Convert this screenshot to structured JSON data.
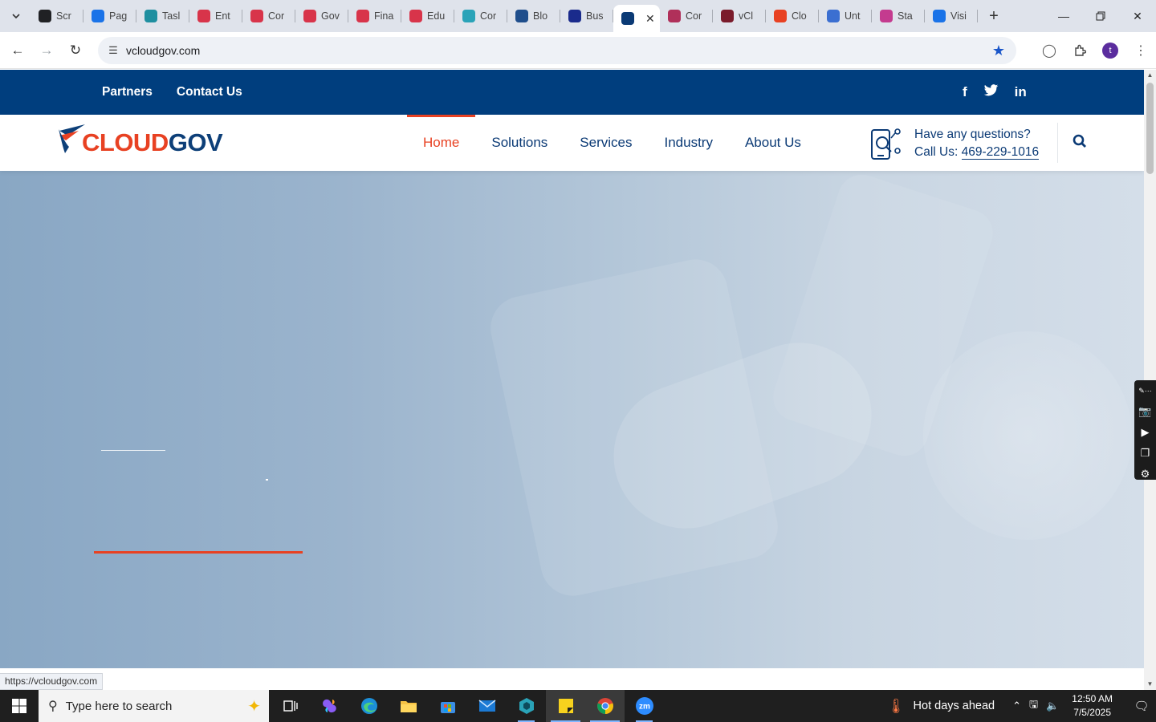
{
  "browser": {
    "tabs": [
      {
        "label": "Scr",
        "icon": "settings-gear-icon",
        "color": "#202124"
      },
      {
        "label": "Pag",
        "icon": "pagespeed-icon",
        "color": "#1a73e8"
      },
      {
        "label": "Tasl",
        "icon": "task-icon",
        "color": "#1e8fa0"
      },
      {
        "label": "Ent",
        "icon": "gov-diamond-icon",
        "color": "#d8344a"
      },
      {
        "label": "Cor",
        "icon": "gov-diamond-icon",
        "color": "#d8344a"
      },
      {
        "label": "Gov",
        "icon": "gov-diamond-icon",
        "color": "#d8344a"
      },
      {
        "label": "Fina",
        "icon": "gov-diamond-icon",
        "color": "#d8344a"
      },
      {
        "label": "Edu",
        "icon": "gov-diamond-icon",
        "color": "#d8344a"
      },
      {
        "label": "Cor",
        "icon": "hex-icon",
        "color": "#2aa3b8"
      },
      {
        "label": "Blo",
        "icon": "scale-icon",
        "color": "#1f4e8c"
      },
      {
        "label": "Bus",
        "icon": "x-logo-icon",
        "color": "#1a2b8c"
      },
      {
        "label": "",
        "icon": "cloudgov-icon",
        "color": "#0b3a75",
        "active": true
      },
      {
        "label": "Cor",
        "icon": "gem-icon",
        "color": "#b0305a"
      },
      {
        "label": "vCl",
        "icon": "v-check-icon",
        "color": "#7a1b2b"
      },
      {
        "label": "Clo",
        "icon": "cloud-swoosh-icon",
        "color": "#e84122"
      },
      {
        "label": "Unt",
        "icon": "doc-icon",
        "color": "#3b6fd1"
      },
      {
        "label": "Sta",
        "icon": "pen-icon",
        "color": "#c43b8f"
      },
      {
        "label": "Visi",
        "icon": "pulse-icon",
        "color": "#1a73e8"
      }
    ],
    "url": "vcloudgov.com",
    "status_url": "https://vcloudgov.com",
    "profile_initial": "t"
  },
  "site": {
    "topbar_links": [
      "Partners",
      "Contact Us"
    ],
    "social": [
      {
        "icon": "facebook-icon",
        "glyph": "f"
      },
      {
        "icon": "twitter-icon",
        "glyph": "🐦"
      },
      {
        "icon": "linkedin-icon",
        "glyph": "in"
      }
    ],
    "logo": {
      "part1": "CLOUD",
      "part2": "GOV"
    },
    "menu": [
      {
        "label": "Home",
        "active": true
      },
      {
        "label": "Solutions"
      },
      {
        "label": "Services"
      },
      {
        "label": "Industry"
      },
      {
        "label": "About Us"
      }
    ],
    "contact": {
      "question": "Have any questions?",
      "call_prefix": "Call Us: ",
      "phone": "469-229-1016"
    },
    "colors": {
      "brand_blue": "#003e7e",
      "accent_red": "#e84122"
    }
  },
  "taskbar": {
    "search_placeholder": "Type here to search",
    "weather": "Hot days ahead",
    "time": "12:50 AM",
    "date": "7/5/2025"
  }
}
